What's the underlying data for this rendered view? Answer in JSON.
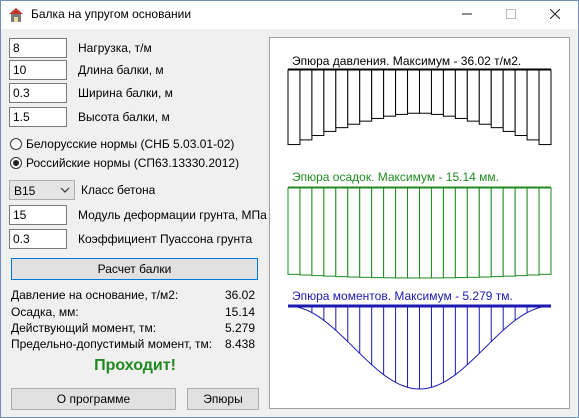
{
  "window": {
    "title": "Балка на упругом основании",
    "app_icon": "house-icon",
    "minimize_icon": "minimize-icon",
    "maximize_icon": "maximize-icon",
    "close_icon": "close-icon"
  },
  "inputs": [
    {
      "name": "load-field",
      "value": "8",
      "label": "Нагрузка, т/м"
    },
    {
      "name": "length-field",
      "value": "10",
      "label": "Длина  балки, м"
    },
    {
      "name": "width-field",
      "value": "0.3",
      "label": "Ширина балки, м"
    },
    {
      "name": "height-field",
      "value": "1.5",
      "label": "Высота балки, м"
    }
  ],
  "norms": [
    {
      "label": "Белорусские нормы (СНБ 5.03.01-02)",
      "selected": false
    },
    {
      "label": "Российские нормы (СП63.13330.2012)",
      "selected": true
    }
  ],
  "concrete": {
    "selected": "B15",
    "label": "Класс бетона"
  },
  "soil": [
    {
      "name": "modulus-field",
      "value": "15",
      "label": "Модуль деформации грунта, МПа"
    },
    {
      "name": "poisson-field",
      "value": "0.3",
      "label": "Коэффициент Пуассона грунта"
    }
  ],
  "buttons": {
    "calculate": "Расчет балки",
    "about": "О программе",
    "diagrams": "Эпюры"
  },
  "results": [
    {
      "label": "Давление на основание, т/м2:",
      "value": "36.02"
    },
    {
      "label": "Осадка, мм:",
      "value": "15.14"
    },
    {
      "label": "Действующий момент, тм:",
      "value": "5.279"
    },
    {
      "label": "Предельно-допустимый момент, тм:",
      "value": "8.438"
    }
  ],
  "status": {
    "text": "Проходит!",
    "color": "#1f8a1f"
  },
  "diagrams": {
    "pressure": {
      "title": "Эпюра давления. Максимум - 36.02 т/м2.",
      "color": "#000000",
      "max": 36.02,
      "unit": "т/м2"
    },
    "settlement": {
      "title": "Эпюра осадок. Максимум - 15.14 мм.",
      "color": "#1f8a1f",
      "max": 15.14,
      "unit": "мм"
    },
    "moment": {
      "title": "Эпюра моментов. Максимум - 5.279 тм.",
      "color": "#1a1ab0",
      "max": 5.279,
      "unit": "тм"
    }
  }
}
